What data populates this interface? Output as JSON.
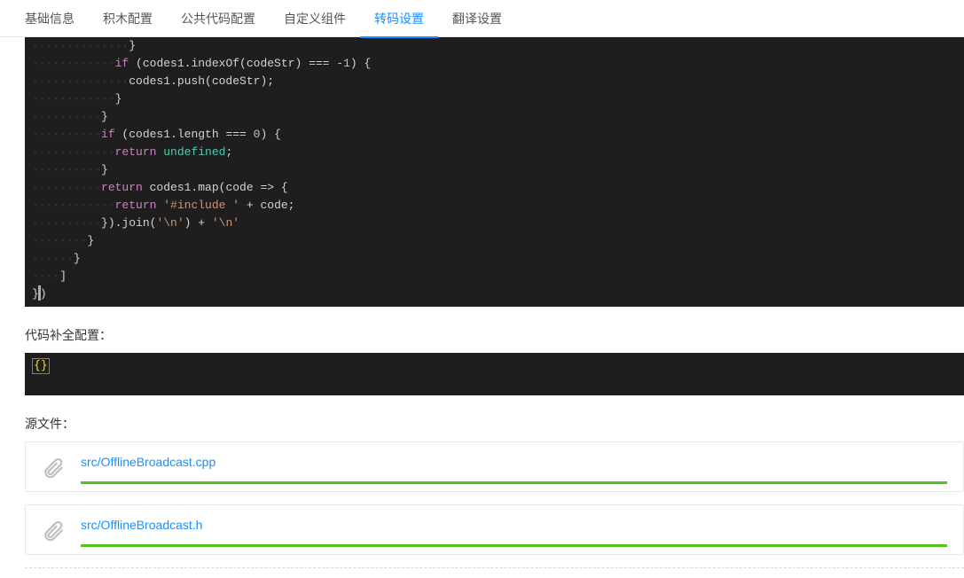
{
  "tabs": [
    {
      "label": "基础信息",
      "active": false
    },
    {
      "label": "积木配置",
      "active": false
    },
    {
      "label": "公共代码配置",
      "active": false
    },
    {
      "label": "自定义组件",
      "active": false
    },
    {
      "label": "转码设置",
      "active": true
    },
    {
      "label": "翻译设置",
      "active": false
    }
  ],
  "code_lines": [
    {
      "indent": 14,
      "tokens": [
        {
          "t": "}",
          "c": ""
        }
      ]
    },
    {
      "indent": 12,
      "tokens": [
        {
          "t": "if",
          "c": "kw"
        },
        {
          "t": " (codes1.indexOf(codeStr) === ",
          "c": ""
        },
        {
          "t": "-1",
          "c": "num"
        },
        {
          "t": ") {",
          "c": ""
        }
      ]
    },
    {
      "indent": 14,
      "tokens": [
        {
          "t": "codes1.push(codeStr);",
          "c": ""
        }
      ]
    },
    {
      "indent": 12,
      "tokens": [
        {
          "t": "}",
          "c": ""
        }
      ]
    },
    {
      "indent": 10,
      "tokens": [
        {
          "t": "}",
          "c": ""
        }
      ]
    },
    {
      "indent": 10,
      "tokens": [
        {
          "t": "if",
          "c": "kw"
        },
        {
          "t": " (codes1.length === ",
          "c": ""
        },
        {
          "t": "0",
          "c": "num"
        },
        {
          "t": ") {",
          "c": ""
        }
      ]
    },
    {
      "indent": 12,
      "tokens": [
        {
          "t": "return",
          "c": "kw"
        },
        {
          "t": " ",
          "c": ""
        },
        {
          "t": "undefined",
          "c": "teal"
        },
        {
          "t": ";",
          "c": ""
        }
      ]
    },
    {
      "indent": 10,
      "tokens": [
        {
          "t": "}",
          "c": ""
        }
      ]
    },
    {
      "indent": 10,
      "tokens": [
        {
          "t": "return",
          "c": "kw"
        },
        {
          "t": " codes1.map(code => {",
          "c": ""
        }
      ]
    },
    {
      "indent": 12,
      "tokens": [
        {
          "t": "return",
          "c": "kw"
        },
        {
          "t": " ",
          "c": ""
        },
        {
          "t": "'#include '",
          "c": "str"
        },
        {
          "t": " + code;",
          "c": ""
        }
      ]
    },
    {
      "indent": 10,
      "tokens": [
        {
          "t": "}).join(",
          "c": ""
        },
        {
          "t": "'\\n'",
          "c": "str"
        },
        {
          "t": ") + ",
          "c": ""
        },
        {
          "t": "'\\n'",
          "c": "str"
        }
      ]
    },
    {
      "indent": 8,
      "tokens": [
        {
          "t": "}",
          "c": ""
        }
      ]
    },
    {
      "indent": 6,
      "tokens": [
        {
          "t": "}",
          "c": ""
        }
      ]
    },
    {
      "indent": 4,
      "tokens": [
        {
          "t": "]",
          "c": ""
        }
      ]
    },
    {
      "indent": 0,
      "tokens": [
        {
          "t": "}",
          "c": ""
        },
        {
          "t": "CURSOR",
          "c": "cursor-marker"
        },
        {
          "t": ")",
          "c": ""
        }
      ]
    }
  ],
  "section_code_complete_label": "代码补全配置：",
  "mini_code_value": "{}",
  "section_source_files_label": "源文件：",
  "files": [
    {
      "name": "src/OfflineBroadcast.cpp"
    },
    {
      "name": "src/OfflineBroadcast.h"
    }
  ]
}
